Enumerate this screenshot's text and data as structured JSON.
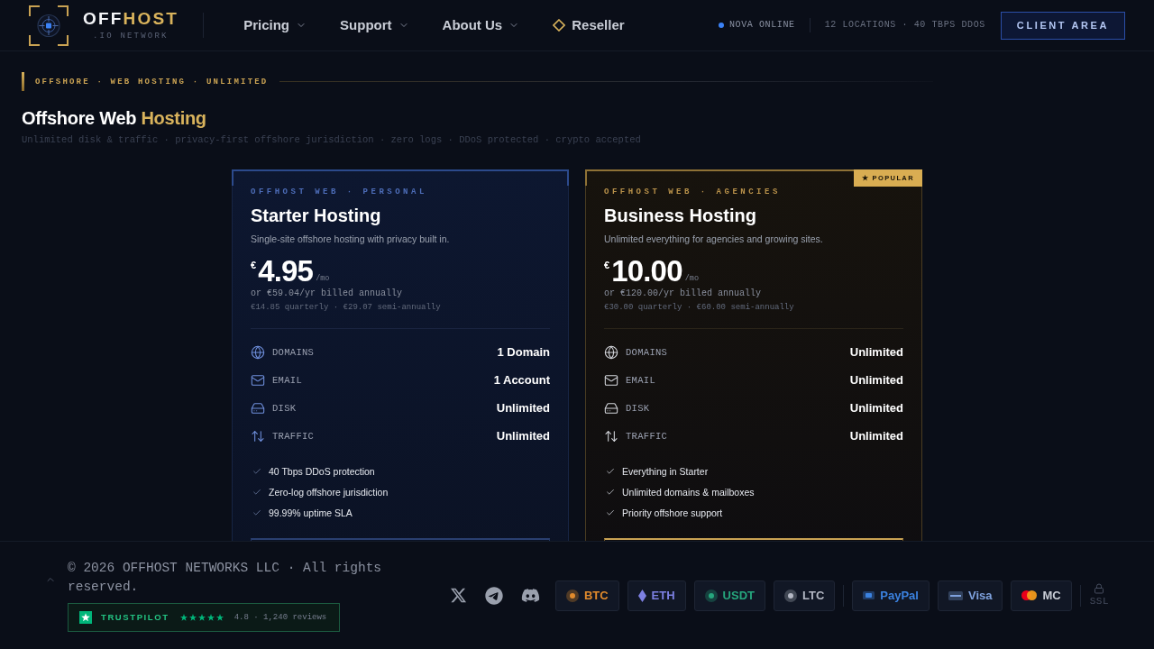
{
  "header": {
    "brand": {
      "name": "OFF",
      "accent": "HOST",
      "tagline": ".IO NETWORK"
    },
    "nav": [
      {
        "label": "Pricing",
        "kind": "menu"
      },
      {
        "label": "Support",
        "kind": "menu"
      },
      {
        "label": "About Us",
        "kind": "menu"
      },
      {
        "label": "Reseller",
        "kind": "featured"
      }
    ],
    "status": {
      "label": "NOVA ONLINE",
      "online": true
    },
    "stats": "12 LOCATIONS · 40 TBPS DDOS",
    "cta": "CLIENT AREA"
  },
  "hero": {
    "eyebrow": "OFFSHORE · WEB HOSTING · UNLIMITED",
    "title": "Offshore Web",
    "title_accent": "Hosting",
    "subtitle": "Unlimited disk & traffic · privacy-first offshore jurisdiction · zero logs · DDoS protected · crypto accepted"
  },
  "plans": [
    {
      "featured": false,
      "tagline": "OFFHOST WEB · PERSONAL",
      "name": "Starter Hosting",
      "description": "Single-site offshore hosting with privacy built in.",
      "currency": "€",
      "price": "4.95",
      "period": "/mo",
      "annual": "or €59.04/yr billed annually",
      "terms": "€14.85 quarterly · €29.07 semi-annually",
      "specs": [
        {
          "label": "DOMAINS",
          "value": "1 Domain"
        },
        {
          "label": "EMAIL",
          "value": "1 Account"
        },
        {
          "label": "DISK",
          "value": "Unlimited"
        },
        {
          "label": "TRAFFIC",
          "value": "Unlimited"
        }
      ],
      "features": [
        "40 Tbps DDoS protection",
        "Zero-log offshore jurisdiction",
        "99.99% uptime SLA"
      ]
    },
    {
      "featured": true,
      "badge": "★ POPULAR",
      "tagline": "OFFHOST WEB · AGENCIES",
      "name": "Business Hosting",
      "description": "Unlimited everything for agencies and growing sites.",
      "currency": "€",
      "price": "10.00",
      "period": "/mo",
      "annual": "or €120.00/yr billed annually",
      "terms": "€30.00 quarterly · €60.00 semi-annually",
      "specs": [
        {
          "label": "DOMAINS",
          "value": "Unlimited"
        },
        {
          "label": "EMAIL",
          "value": "Unlimited"
        },
        {
          "label": "DISK",
          "value": "Unlimited"
        },
        {
          "label": "TRAFFIC",
          "value": "Unlimited"
        }
      ],
      "features": [
        "Everything in Starter",
        "Unlimited domains & mailboxes",
        "Priority offshore support"
      ]
    }
  ],
  "footer": {
    "copyright": "© 2026 OFFHOST NETWORKS LLC · All rights reserved.",
    "trustpilot": {
      "label": "TRUSTPILOT",
      "stars": 5,
      "rating": "4.8 · 1,240 reviews"
    },
    "crypto": [
      {
        "label": "BTC",
        "kind": "coin",
        "color": "#e08a2c"
      },
      {
        "label": "ETH",
        "kind": "gem",
        "color": "#7d80e2"
      },
      {
        "label": "USDT",
        "kind": "coin",
        "color": "#26a67d"
      },
      {
        "label": "LTC",
        "kind": "coin",
        "color": "#b4b8c4"
      }
    ],
    "cards": [
      {
        "label": "PayPal",
        "kind": "tag",
        "color": "#3b82e0"
      },
      {
        "label": "Visa",
        "kind": "card",
        "color": "#7fa2de"
      },
      {
        "label": "MC",
        "kind": "rings",
        "color": "#c9cdd6"
      }
    ],
    "ssl": "SSL"
  }
}
